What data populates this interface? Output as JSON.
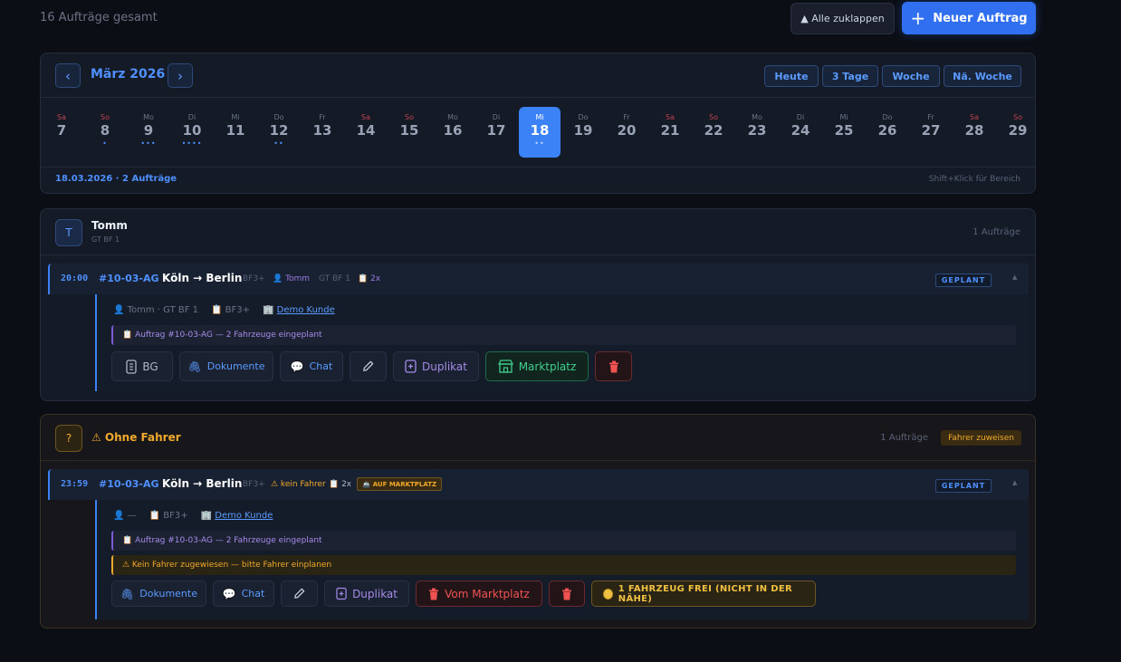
{
  "header": {
    "total_label": "16 Aufträge gesamt",
    "collapse_label": "▲ Alle zuklappen",
    "new_order_label": "Neuer Auftrag"
  },
  "calendar": {
    "month_label": "März 2026",
    "prev_icon": "‹",
    "next_icon": "›",
    "quick": [
      "Heute",
      "3 Tage",
      "Woche",
      "Nä. Woche"
    ],
    "days": [
      {
        "dn": "Sa",
        "dd": "7",
        "dots": "",
        "we": true
      },
      {
        "dn": "So",
        "dd": "8",
        "dots": "•",
        "we": true
      },
      {
        "dn": "Mo",
        "dd": "9",
        "dots": "•••",
        "we": false
      },
      {
        "dn": "Di",
        "dd": "10",
        "dots": "••••",
        "we": false
      },
      {
        "dn": "Mi",
        "dd": "11",
        "dots": "",
        "we": false
      },
      {
        "dn": "Do",
        "dd": "12",
        "dots": "••",
        "we": false
      },
      {
        "dn": "Fr",
        "dd": "13",
        "dots": "",
        "we": false
      },
      {
        "dn": "Sa",
        "dd": "14",
        "dots": "",
        "we": true
      },
      {
        "dn": "So",
        "dd": "15",
        "dots": "",
        "we": true
      },
      {
        "dn": "Mo",
        "dd": "16",
        "dots": "",
        "we": false
      },
      {
        "dn": "Di",
        "dd": "17",
        "dots": "",
        "we": false
      },
      {
        "dn": "Mi",
        "dd": "18",
        "dots": "••",
        "we": false,
        "selected": true
      },
      {
        "dn": "Do",
        "dd": "19",
        "dots": "",
        "we": false
      },
      {
        "dn": "Fr",
        "dd": "20",
        "dots": "",
        "we": false
      },
      {
        "dn": "Sa",
        "dd": "21",
        "dots": "",
        "we": true
      },
      {
        "dn": "So",
        "dd": "22",
        "dots": "",
        "we": true
      },
      {
        "dn": "Mo",
        "dd": "23",
        "dots": "",
        "we": false
      },
      {
        "dn": "Di",
        "dd": "24",
        "dots": "",
        "we": false
      },
      {
        "dn": "Mi",
        "dd": "25",
        "dots": "",
        "we": false
      },
      {
        "dn": "Do",
        "dd": "26",
        "dots": "",
        "we": false
      },
      {
        "dn": "Fr",
        "dd": "27",
        "dots": "",
        "we": false
      },
      {
        "dn": "Sa",
        "dd": "28",
        "dots": "",
        "we": true
      },
      {
        "dn": "So",
        "dd": "29",
        "dots": "",
        "we": true
      }
    ],
    "footer_label": "18.03.2026 · 2 Aufträge",
    "hint": "Shift+Klick für Bereich"
  },
  "group1": {
    "avatar": "T",
    "name": "Tomm",
    "sub": "GT BF 1",
    "count": "1 Aufträge",
    "order": {
      "time": "20:00",
      "number": "#10-03-AG",
      "route": "Köln → Berlin",
      "class": "BF3+",
      "driver": "👤 Tomm",
      "vehicle": "GT BF 1",
      "qty": "📋 2x",
      "status": "GEPLANT",
      "caret": "▲",
      "info_driver": "👤 Tomm · GT BF 1",
      "info_class": "📋 BF3+",
      "info_customer_icon": "🏢",
      "info_customer": "Demo Kunde",
      "note": "📋 Auftrag #10-03-AG — 2 Fahrzeuge eingeplant",
      "actions": {
        "bg": "BG",
        "docs": "Dokumente",
        "chat": "Chat",
        "dup": "Duplikat",
        "market": "Marktplatz"
      }
    }
  },
  "group2": {
    "avatar": "?",
    "name": "⚠ Ohne Fahrer",
    "count": "1 Aufträge",
    "assign": "Fahrer zuweisen",
    "order": {
      "time": "23:59",
      "number": "#10-03-AG",
      "route": "Köln → Berlin",
      "class": "BF3+",
      "no_driver": "⚠ kein Fahrer",
      "qty": "📋 2x",
      "market_badge": "AUF MARKTPLATZ",
      "status": "GEPLANT",
      "caret": "▲",
      "info_driver": "👤 —",
      "info_class": "📋 BF3+",
      "info_customer_icon": "🏢",
      "info_customer": "Demo Kunde",
      "note": "📋 Auftrag #10-03-AG — 2 Fahrzeuge eingeplant",
      "warning": "⚠ Kein Fahrer zugewiesen — bitte Fahrer einplanen",
      "actions": {
        "docs": "Dokumente",
        "chat": "Chat",
        "dup": "Duplikat",
        "remove_market": "Vom Marktplatz",
        "free": "1 FAHRZEUG FREI (NICHT IN DER NÄHE)"
      }
    }
  }
}
